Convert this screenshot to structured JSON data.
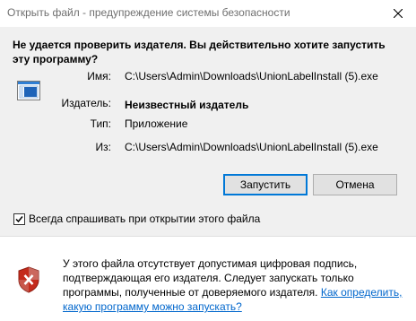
{
  "window": {
    "title": "Открыть файл - предупреждение системы безопасности"
  },
  "headline": "Не удается проверить издателя.  Вы действительно хотите запустить эту программу?",
  "details": {
    "name_label": "Имя:",
    "name_value": "C:\\Users\\Admin\\Downloads\\UnionLabelInstall (5).exe",
    "publisher_label": "Издатель:",
    "publisher_value": "Неизвестный издатель",
    "type_label": "Тип:",
    "type_value": "Приложение",
    "from_label": "Из:",
    "from_value": "C:\\Users\\Admin\\Downloads\\UnionLabelInstall (5).exe"
  },
  "buttons": {
    "run": "Запустить",
    "cancel": "Отмена"
  },
  "checkbox": {
    "label": "Всегда спрашивать при открытии этого файла",
    "checked": true
  },
  "warning": {
    "text": "У этого файла отсутствует допустимая цифровая подпись, подтверждающая его издателя.  Следует запускать только программы, полученные от доверяемого издателя.",
    "link": "Как определить, какую программу можно запускать?"
  },
  "icons": {
    "close": "close-icon",
    "app": "application-window-icon",
    "shield": "security-shield-error-icon",
    "check": "checkmark-icon"
  },
  "colors": {
    "link": "#0066cc",
    "primary_border": "#0078d7",
    "shield_red": "#c42b1c"
  }
}
